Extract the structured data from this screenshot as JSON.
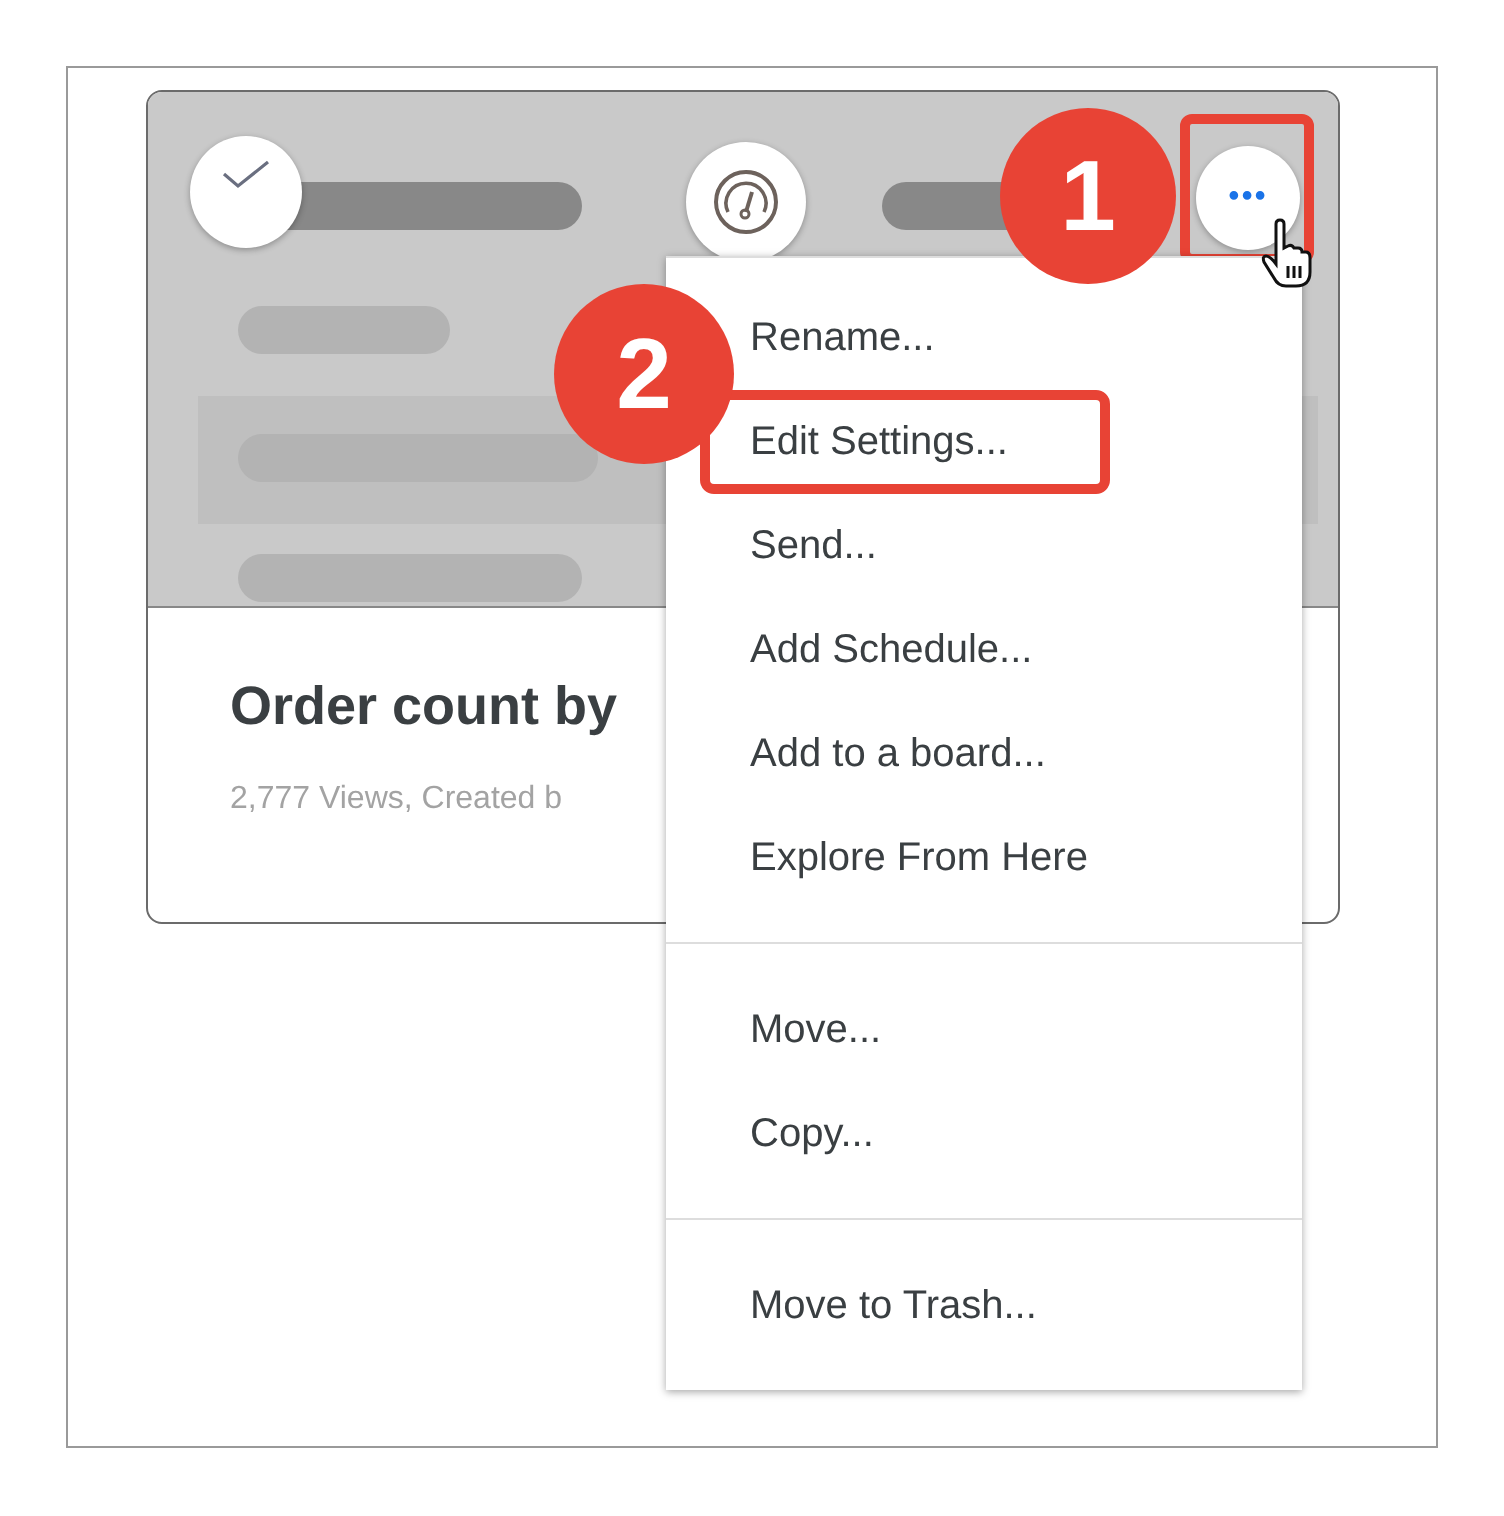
{
  "card": {
    "checkbox": {
      "checked": false
    },
    "title": "Order count by",
    "subtitle": "2,777 Views, Created b",
    "more_button": {
      "label": "•••",
      "highlighted": true
    }
  },
  "menu": {
    "groups": [
      {
        "items": [
          {
            "label": "Rename...",
            "highlighted": false
          },
          {
            "label": "Edit Settings...",
            "highlighted": true
          },
          {
            "label": "Send...",
            "highlighted": false
          },
          {
            "label": "Add Schedule...",
            "highlighted": false
          },
          {
            "label": "Add to a board...",
            "highlighted": false
          },
          {
            "label": "Explore From Here",
            "highlighted": false
          }
        ]
      },
      {
        "items": [
          {
            "label": "Move...",
            "highlighted": false
          },
          {
            "label": "Copy...",
            "highlighted": false
          }
        ]
      },
      {
        "items": [
          {
            "label": "Move to Trash...",
            "highlighted": false
          }
        ]
      }
    ]
  },
  "annotations": [
    {
      "label": "1"
    },
    {
      "label": "2"
    }
  ]
}
